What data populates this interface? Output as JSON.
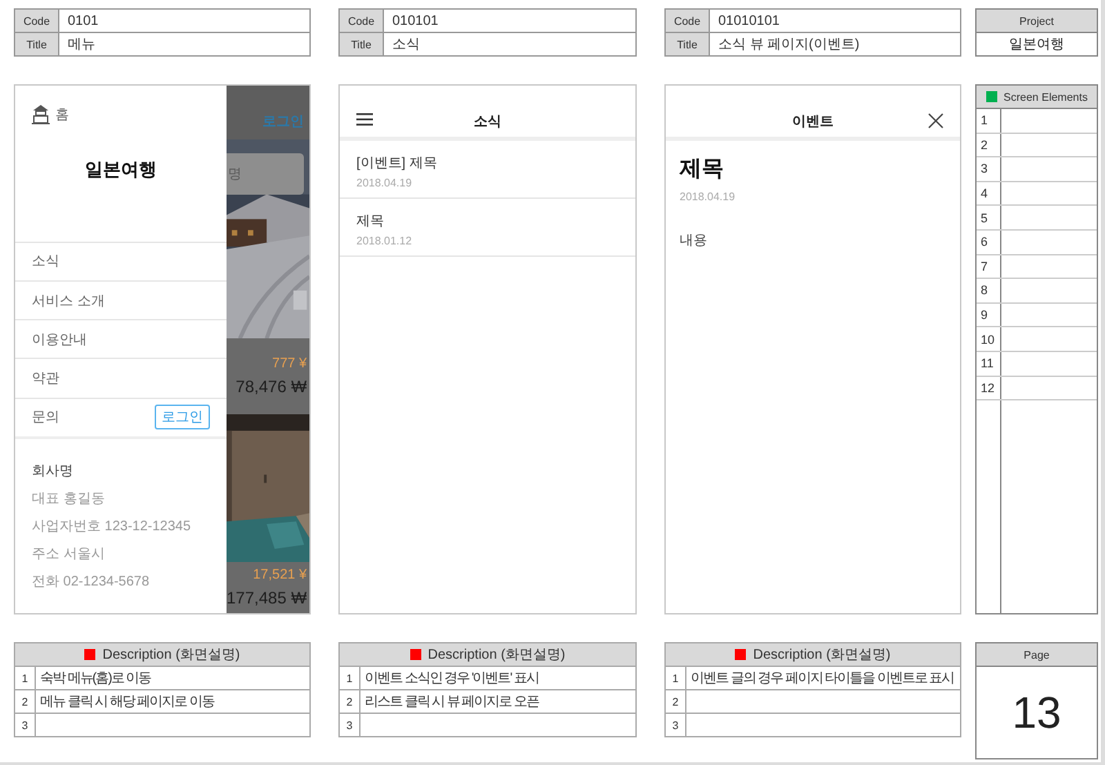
{
  "screens": [
    {
      "kind": "menu",
      "code_label": "Code",
      "code": "0101",
      "title_label": "Title",
      "title": "메뉴",
      "phone": {
        "home_label": "홈",
        "brand": "일본여행",
        "menu": [
          {
            "label": "소식"
          },
          {
            "label": "서비스 소개"
          },
          {
            "label": "이용안내"
          },
          {
            "label": "약관"
          },
          {
            "label": "문의",
            "button": "로그인"
          }
        ],
        "company": {
          "name": "회사명",
          "lines": [
            "대표 홍길동",
            "사업자번호 123-12-12345",
            "주소 서울시",
            "전화 02-1234-5678"
          ]
        },
        "behind": {
          "login": "로그인",
          "search_hint": "명",
          "cards": [
            {
              "yen": "777 ¥",
              "won": "78,476 ₩"
            },
            {
              "yen": "17,521 ¥",
              "won": "177,485 ₩"
            }
          ]
        }
      },
      "description": {
        "title": "Description (화면설명)",
        "rows": [
          {
            "num": "1",
            "text": "숙박 메뉴(홈)로 이동"
          },
          {
            "num": "2",
            "text": "메뉴 클릭 시 해당 페이지로 이동"
          },
          {
            "num": "3"
          }
        ]
      }
    },
    {
      "kind": "list",
      "code_label": "Code",
      "code": "010101",
      "title_label": "Title",
      "title": "소식",
      "phone": {
        "header": "소식",
        "items": [
          {
            "title": "[이벤트] 제목",
            "date": "2018.04.19"
          },
          {
            "title": "제목",
            "date": "2018.01.12"
          }
        ]
      },
      "description": {
        "title": "Description (화면설명)",
        "rows": [
          {
            "num": "1",
            "text": "이벤트 소식인 경우 '이벤트' 표시"
          },
          {
            "num": "2",
            "text": "리스트 클릭 시 뷰 페이지로 오픈"
          },
          {
            "num": "3"
          }
        ]
      }
    },
    {
      "kind": "detail",
      "code_label": "Code",
      "code": "01010101",
      "title_label": "Title",
      "title": "소식 뷰 페이지(이벤트)",
      "phone": {
        "header": "이벤트",
        "heading": "제목",
        "date": "2018.04.19",
        "body": "내용"
      },
      "description": {
        "title": "Description (화면설명)",
        "rows": [
          {
            "num": "1",
            "text": "이벤트 글의 경우 페이지 타이틀을 이벤트로 표시"
          },
          {
            "num": "2"
          },
          {
            "num": "3"
          }
        ]
      }
    }
  ],
  "project": {
    "label": "Project",
    "name": "일본여행"
  },
  "screen_elements": {
    "title": "Screen Elements",
    "rows": [
      "1",
      "2",
      "3",
      "4",
      "5",
      "6",
      "7",
      "8",
      "9",
      "10",
      "11",
      "12"
    ]
  },
  "page": {
    "label": "Page",
    "number": "13"
  }
}
